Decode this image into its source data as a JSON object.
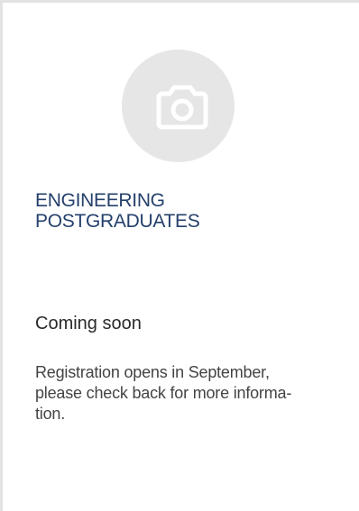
{
  "card": {
    "image_icon": "camera-icon",
    "title_lines": [
      "ENGINEERING",
      "POSTGRADUATES"
    ],
    "status": "Coming soon",
    "description_lines": [
      "Registration opens in September,",
      "please check back for more informa-",
      "tion."
    ]
  },
  "colors": {
    "title": "#24406b",
    "placeholder_bg": "#e6e6e6",
    "border": "#e3e3e3"
  }
}
